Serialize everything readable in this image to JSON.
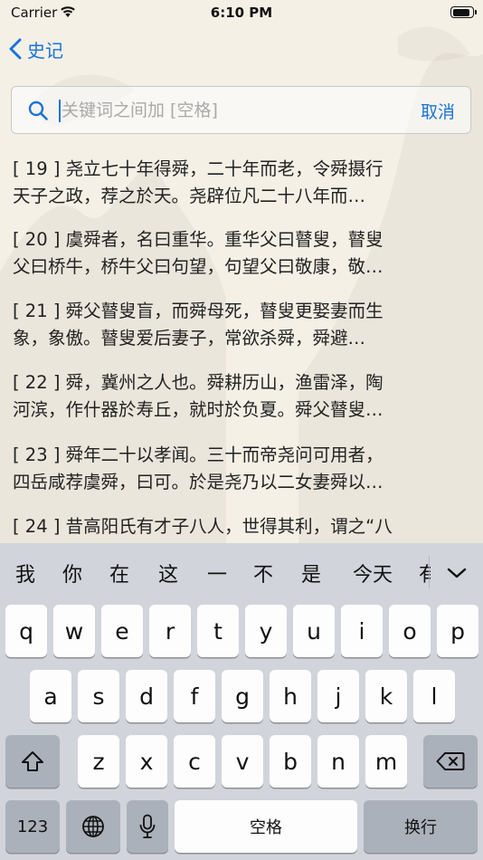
{
  "status_bar": {
    "carrier": "Carrier",
    "time": "6:10 PM",
    "battery_level": 0.92
  },
  "nav": {
    "back_label": "史记"
  },
  "search": {
    "value": "",
    "placeholder": "关键词之间加 [空格]",
    "cancel_label": "取消"
  },
  "results": [
    {
      "line1": "[ 19 ] 尧立七十年得舜，二十年而老，令舜摄行",
      "line2": "天子之政，荐之於天。尧辟位凡二十八年而…"
    },
    {
      "line1": "[ 20 ] 虞舜者，名曰重华。重华父曰瞽叟，瞽叟",
      "line2": "父曰桥牛，桥牛父曰句望，句望父曰敬康，敬…"
    },
    {
      "line1": "[ 21 ] 舜父瞽叟盲，而舜母死，瞽叟更娶妻而生",
      "line2": "象，象傲。瞽叟爱后妻子，常欲杀舜，舜避…"
    },
    {
      "line1": "[ 22 ] 舜，冀州之人也。舜耕历山，渔雷泽，陶",
      "line2": "河滨，作什器於寿丘，就时於负夏。舜父瞽叟…"
    },
    {
      "line1": "[ 23 ] 舜年二十以孝闻。三十而帝尧问可用者，",
      "line2": "四岳咸荐虞舜，曰可。於是尧乃以二女妻舜以…"
    },
    {
      "line1": "[ 24 ] 昔高阳氏有才子八人，世得其利，谓之“八",
      "line2": ""
    }
  ],
  "keyboard": {
    "candidates": [
      "我",
      "你",
      "在",
      "这",
      "一",
      "不",
      "是",
      "今天",
      "有"
    ],
    "row1": [
      "q",
      "w",
      "e",
      "r",
      "t",
      "y",
      "u",
      "i",
      "o",
      "p"
    ],
    "row2": [
      "a",
      "s",
      "d",
      "f",
      "g",
      "h",
      "j",
      "k",
      "l"
    ],
    "row3": [
      "z",
      "x",
      "c",
      "v",
      "b",
      "n",
      "m"
    ],
    "numbers_label": "123",
    "space_label": "空格",
    "return_label": "换行"
  },
  "colors": {
    "accent": "#1a73d9",
    "background": "#f4f0e6",
    "keyboard_bg": "#d1d4db",
    "key_fn": "#abb1ba"
  }
}
